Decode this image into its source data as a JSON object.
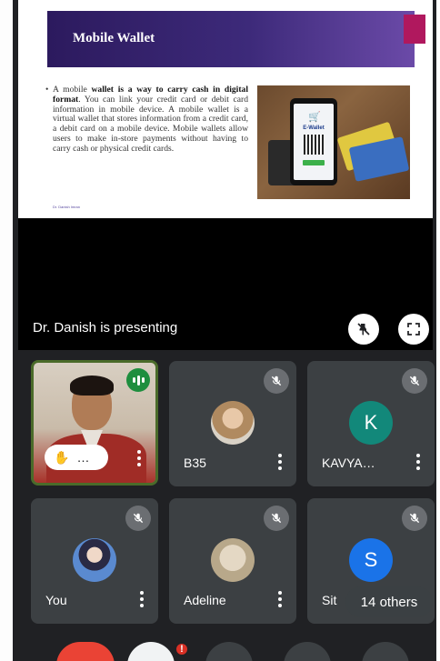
{
  "slide": {
    "title": "Mobile Wallet",
    "bullet": "•",
    "text_lead": "A mobile ",
    "text_bold": "wallet is a way to carry cash in digital format",
    "text_rest": ". You can link your credit card or debit card information in mobile device. A mobile wallet is a virtual wallet that stores information from a credit card, a debit card on a mobile device. Mobile wallets allow users to make in-store payments without having to carry cash or physical credit cards.",
    "footer": "Dr. Danish Imran",
    "image_label": "E-Wallet"
  },
  "presentation": {
    "status": "Dr. Danish is presenting"
  },
  "participants": [
    {
      "name": "",
      "speaking": true,
      "hand_pill": "…",
      "icon": "hand-icon"
    },
    {
      "name": "B35",
      "muted": true,
      "avatar": "photo"
    },
    {
      "name": "KAVYA…",
      "muted": true,
      "avatar_letter": "K",
      "avatar_color": "#12887a"
    },
    {
      "name": "You",
      "muted": true,
      "avatar": "photo"
    },
    {
      "name": "Adeline",
      "muted": true,
      "avatar": "photo"
    },
    {
      "name": "Sit",
      "muted": true,
      "avatar_letter": "S",
      "avatar_color": "#1a73e8"
    }
  ],
  "others": {
    "label": "14 others"
  },
  "controls": {
    "badge": "!"
  },
  "colors": {
    "background": "#202124",
    "tile": "#3c4043",
    "speaking": "#1e8e3e",
    "end_call": "#ea4335"
  }
}
